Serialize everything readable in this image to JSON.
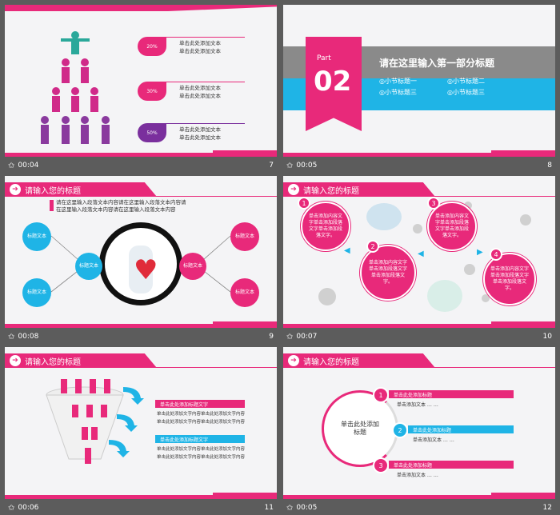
{
  "colors": {
    "pink": "#e8297a",
    "blue": "#1fb4e6",
    "purple": "#7a2f9d",
    "teal": "#2aa89a"
  },
  "slides": [
    {
      "time": "00:04",
      "number": "7",
      "percents": [
        "20%",
        "30%",
        "50%"
      ],
      "text_line": "单击此处添加文本"
    },
    {
      "time": "00:05",
      "number": "8",
      "part_label": "Part",
      "part_number": "02",
      "title": "请在这里输入第一部分标题",
      "items": [
        "◎小节标题一",
        "◎小节标题二",
        "◎小节标题三",
        "◎小节标题三"
      ]
    },
    {
      "time": "00:08",
      "number": "9",
      "header": "请输入您的标题",
      "intro": [
        "请在这里输入段落文本内容请在这里输入段落文本内容请",
        "在这里输入段落文本内容请在这里输入段落文本内容"
      ],
      "node_label": "标题文本"
    },
    {
      "time": "00:07",
      "number": "10",
      "header": "请输入您的标题",
      "steps": [
        "1",
        "2",
        "3",
        "4"
      ],
      "step_text": "单击添加内容文字单击添加段落文字单击添加段落文字。"
    },
    {
      "time": "00:06",
      "number": "11",
      "header": "请输入您的标题",
      "title_a": "单击此处添加标题文字",
      "title_b": "单击此处添加标题文字",
      "row_text": "单击此处添加文字内容"
    },
    {
      "time": "00:05",
      "number": "12",
      "header": "请输入您的标题",
      "center": "单击此处添加标题",
      "labels": [
        "单击此处添加标题",
        "单击此处添加标题",
        "单击此处添加标题"
      ],
      "subtext": "单击添加文本 … …",
      "nums": [
        "1",
        "2",
        "3"
      ]
    }
  ]
}
